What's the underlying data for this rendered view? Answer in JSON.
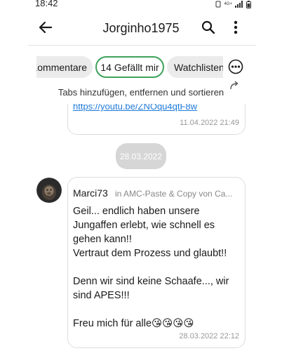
{
  "status_bar": {
    "time": "18:42",
    "network": "4G+"
  },
  "app_bar": {
    "title": "Jorginho1975",
    "icons": [
      "back-arrow-icon",
      "search-icon",
      "more-vert-icon"
    ]
  },
  "tabs": [
    {
      "label": "Kommentare",
      "active": false
    },
    {
      "label": "14 Gefällt mir",
      "active": true
    },
    {
      "label": "Watchlisten",
      "active": false
    }
  ],
  "tabs_hint": "Tabs hinzufügen, entfernen und sortieren",
  "previous_message": {
    "link": "https://youtu.be/ZNOqu4qtF8w",
    "time": "11.04.2022 21:49"
  },
  "date_separator": "28.03.2022",
  "message": {
    "author": "Marci73",
    "group": "in AMC-Paste & Copy von Ca...",
    "body": "Geil... endlich haben unsere Jungaffen erlebt, wie schnell es gehen kann!!\nVertraut dem Prozess und glaubt!!\n\nDenn wir sind keine Schaafe..., wir sind APES!!!\n\nFreu mich für alle😘😘😘😘",
    "time": "28.03.2022 22:12"
  },
  "colors": {
    "active_tab_border": "#3ea35a",
    "link": "#1f7ad9",
    "chip_bg": "#ebebeb",
    "date_pill_bg": "#d6d6d6"
  }
}
